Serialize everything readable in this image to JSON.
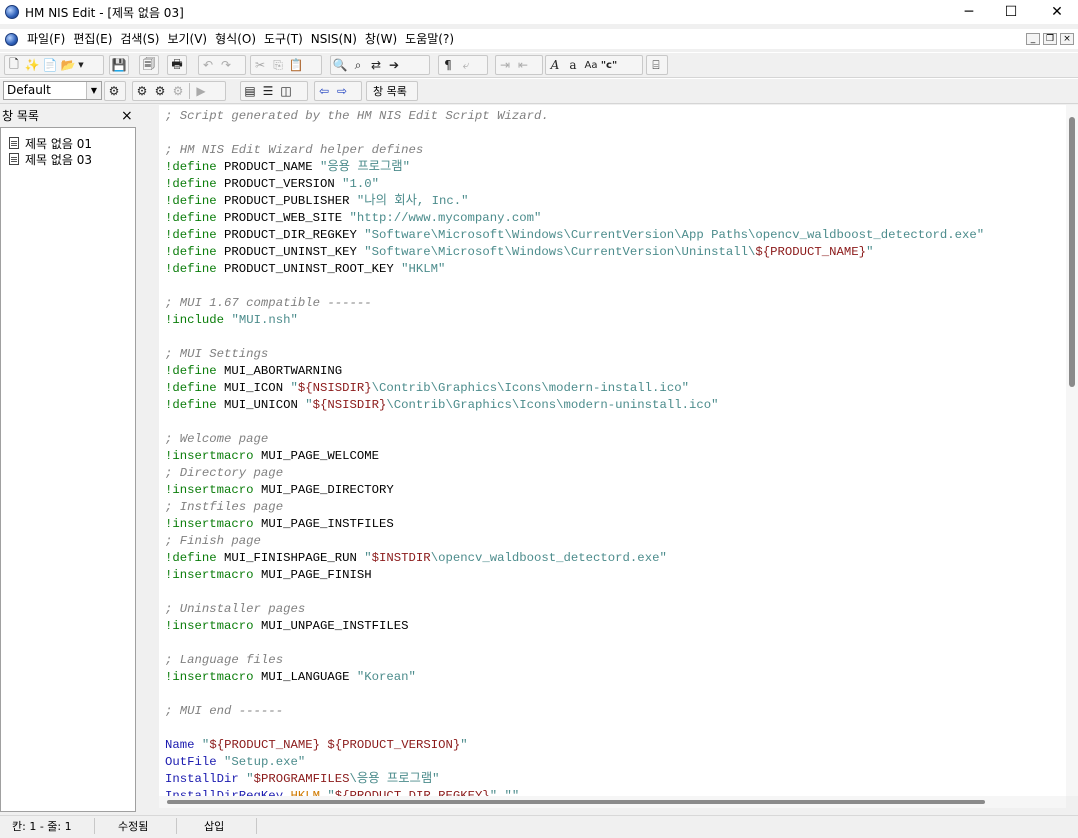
{
  "window": {
    "title": "HM NIS Edit - [제목 없음 03]",
    "minimize": "─",
    "maximize": "☐",
    "close": "✕"
  },
  "menu": [
    "파일(F)",
    "편집(E)",
    "검색(S)",
    "보기(V)",
    "형식(O)",
    "도구(T)",
    "NSIS(N)",
    "창(W)",
    "도움말(?)"
  ],
  "mdi": {
    "min": "_",
    "restore": "❐",
    "close": "×"
  },
  "toolbar2": {
    "combo_value": "Default",
    "window_list_label": "창 목록"
  },
  "panel": {
    "header": "창 목록",
    "close": "×",
    "items": [
      "제목 없음 01",
      "제목 없음 03"
    ]
  },
  "editor": {
    "lines": [
      "; Script generated by the HM NIS Edit Script Wizard.",
      "",
      "; HM NIS Edit Wizard helper defines",
      "!define PRODUCT_NAME \"응용 프로그램\"",
      "!define PRODUCT_VERSION \"1.0\"",
      "!define PRODUCT_PUBLISHER \"나의 회사, Inc.\"",
      "!define PRODUCT_WEB_SITE \"http://www.mycompany.com\"",
      "!define PRODUCT_DIR_REGKEY \"Software\\Microsoft\\Windows\\CurrentVersion\\App Paths\\opencv_waldboost_detectord.exe\"",
      "!define PRODUCT_UNINST_KEY \"Software\\Microsoft\\Windows\\CurrentVersion\\Uninstall\\${PRODUCT_NAME}\"",
      "!define PRODUCT_UNINST_ROOT_KEY \"HKLM\"",
      "",
      "; MUI 1.67 compatible ------",
      "!include \"MUI.nsh\"",
      "",
      "; MUI Settings",
      "!define MUI_ABORTWARNING",
      "!define MUI_ICON \"${NSISDIR}\\Contrib\\Graphics\\Icons\\modern-install.ico\"",
      "!define MUI_UNICON \"${NSISDIR}\\Contrib\\Graphics\\Icons\\modern-uninstall.ico\"",
      "",
      "; Welcome page",
      "!insertmacro MUI_PAGE_WELCOME",
      "; Directory page",
      "!insertmacro MUI_PAGE_DIRECTORY",
      "; Instfiles page",
      "!insertmacro MUI_PAGE_INSTFILES",
      "; Finish page",
      "!define MUI_FINISHPAGE_RUN \"$INSTDIR\\opencv_waldboost_detectord.exe\"",
      "!insertmacro MUI_PAGE_FINISH",
      "",
      "; Uninstaller pages",
      "!insertmacro MUI_UNPAGE_INSTFILES",
      "",
      "; Language files",
      "!insertmacro MUI_LANGUAGE \"Korean\"",
      "",
      "; MUI end ------",
      "",
      "Name \"${PRODUCT_NAME} ${PRODUCT_VERSION}\"",
      "OutFile \"Setup.exe\"",
      "InstallDir \"$PROGRAMFILES\\응용 프로그램\"",
      "InstallDirRegKey HKLM \"${PRODUCT_DIR_REGKEY}\" \"\""
    ]
  },
  "status": {
    "position": "칸: 1 - 줄: 1",
    "modified": "수정됨",
    "mode": "삽입"
  }
}
